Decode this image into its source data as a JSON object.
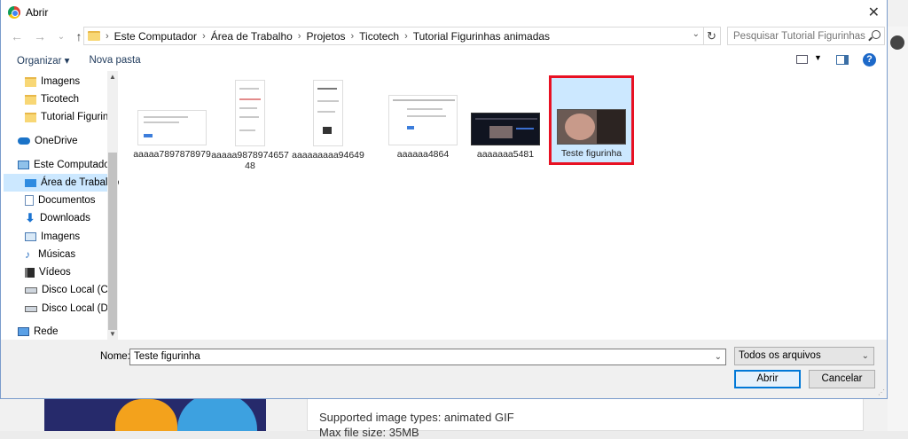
{
  "dialog": {
    "title": "Abrir",
    "close_glyph": "✕"
  },
  "nav": {
    "back_glyph": "←",
    "forward_glyph": "→",
    "up_glyph": "↑",
    "breadcrumbs": [
      "Este Computador",
      "Área de Trabalho",
      "Projetos",
      "Ticotech",
      "Tutorial Figurinhas animadas"
    ],
    "separator": "›",
    "refresh_glyph": "↻",
    "search_placeholder": "Pesquisar Tutorial Figurinhas ..."
  },
  "toolbar": {
    "organize_label": "Organizar ▾",
    "new_folder_label": "Nova pasta",
    "help_label": "?"
  },
  "sidebar": {
    "items": [
      {
        "label": "Imagens",
        "icon": "folder-icon"
      },
      {
        "label": "Ticotech",
        "icon": "folder-icon"
      },
      {
        "label": "Tutorial Figurinh",
        "icon": "folder-icon"
      },
      {
        "label": "OneDrive",
        "icon": "cloud-icon"
      },
      {
        "label": "Este Computador",
        "icon": "computer-icon"
      },
      {
        "label": "Área de Trabalho",
        "icon": "desktop-icon",
        "selected": true
      },
      {
        "label": "Documentos",
        "icon": "document-icon"
      },
      {
        "label": "Downloads",
        "icon": "download-icon"
      },
      {
        "label": "Imagens",
        "icon": "pictures-icon"
      },
      {
        "label": "Músicas",
        "icon": "music-icon"
      },
      {
        "label": "Vídeos",
        "icon": "video-icon"
      },
      {
        "label": "Disco Local (C:)",
        "icon": "drive-icon"
      },
      {
        "label": "Disco Local (D:)",
        "icon": "drive-icon"
      },
      {
        "label": "Rede",
        "icon": "network-icon"
      }
    ]
  },
  "files": [
    {
      "name": "aaaaa7897878979"
    },
    {
      "name": "aaaaa9878974657 48"
    },
    {
      "name": "aaaaaaaaa94649"
    },
    {
      "name": "aaaaaa4864"
    },
    {
      "name": "aaaaaaa5481"
    },
    {
      "name": "Teste figurinha",
      "selected": true
    }
  ],
  "footer": {
    "name_label": "Nome:",
    "name_value": "Teste figurinha",
    "file_type": "Todos os arquivos",
    "open_label": "Abrir",
    "cancel_label": "Cancelar"
  },
  "background": {
    "line1": "Supported image types: animated GIF",
    "line2": "Max file size: 35MB"
  },
  "colors": {
    "selection": "#cce8ff",
    "highlight_border": "#e81123",
    "accent": "#0078d7"
  }
}
